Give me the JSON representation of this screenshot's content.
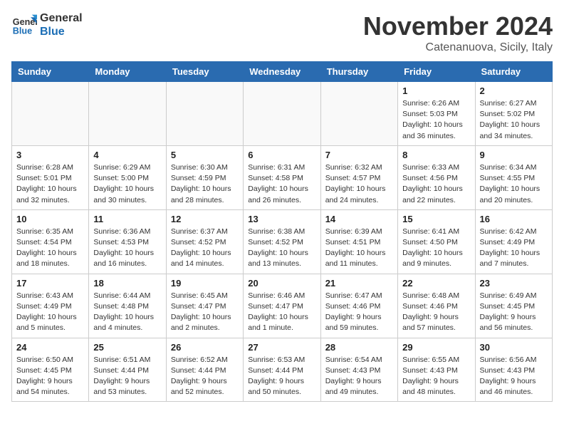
{
  "header": {
    "logo_line1": "General",
    "logo_line2": "Blue",
    "month_title": "November 2024",
    "location": "Catenanuova, Sicily, Italy"
  },
  "weekdays": [
    "Sunday",
    "Monday",
    "Tuesday",
    "Wednesday",
    "Thursday",
    "Friday",
    "Saturday"
  ],
  "weeks": [
    [
      {
        "day": "",
        "info": ""
      },
      {
        "day": "",
        "info": ""
      },
      {
        "day": "",
        "info": ""
      },
      {
        "day": "",
        "info": ""
      },
      {
        "day": "",
        "info": ""
      },
      {
        "day": "1",
        "info": "Sunrise: 6:26 AM\nSunset: 5:03 PM\nDaylight: 10 hours and 36 minutes."
      },
      {
        "day": "2",
        "info": "Sunrise: 6:27 AM\nSunset: 5:02 PM\nDaylight: 10 hours and 34 minutes."
      }
    ],
    [
      {
        "day": "3",
        "info": "Sunrise: 6:28 AM\nSunset: 5:01 PM\nDaylight: 10 hours and 32 minutes."
      },
      {
        "day": "4",
        "info": "Sunrise: 6:29 AM\nSunset: 5:00 PM\nDaylight: 10 hours and 30 minutes."
      },
      {
        "day": "5",
        "info": "Sunrise: 6:30 AM\nSunset: 4:59 PM\nDaylight: 10 hours and 28 minutes."
      },
      {
        "day": "6",
        "info": "Sunrise: 6:31 AM\nSunset: 4:58 PM\nDaylight: 10 hours and 26 minutes."
      },
      {
        "day": "7",
        "info": "Sunrise: 6:32 AM\nSunset: 4:57 PM\nDaylight: 10 hours and 24 minutes."
      },
      {
        "day": "8",
        "info": "Sunrise: 6:33 AM\nSunset: 4:56 PM\nDaylight: 10 hours and 22 minutes."
      },
      {
        "day": "9",
        "info": "Sunrise: 6:34 AM\nSunset: 4:55 PM\nDaylight: 10 hours and 20 minutes."
      }
    ],
    [
      {
        "day": "10",
        "info": "Sunrise: 6:35 AM\nSunset: 4:54 PM\nDaylight: 10 hours and 18 minutes."
      },
      {
        "day": "11",
        "info": "Sunrise: 6:36 AM\nSunset: 4:53 PM\nDaylight: 10 hours and 16 minutes."
      },
      {
        "day": "12",
        "info": "Sunrise: 6:37 AM\nSunset: 4:52 PM\nDaylight: 10 hours and 14 minutes."
      },
      {
        "day": "13",
        "info": "Sunrise: 6:38 AM\nSunset: 4:52 PM\nDaylight: 10 hours and 13 minutes."
      },
      {
        "day": "14",
        "info": "Sunrise: 6:39 AM\nSunset: 4:51 PM\nDaylight: 10 hours and 11 minutes."
      },
      {
        "day": "15",
        "info": "Sunrise: 6:41 AM\nSunset: 4:50 PM\nDaylight: 10 hours and 9 minutes."
      },
      {
        "day": "16",
        "info": "Sunrise: 6:42 AM\nSunset: 4:49 PM\nDaylight: 10 hours and 7 minutes."
      }
    ],
    [
      {
        "day": "17",
        "info": "Sunrise: 6:43 AM\nSunset: 4:49 PM\nDaylight: 10 hours and 5 minutes."
      },
      {
        "day": "18",
        "info": "Sunrise: 6:44 AM\nSunset: 4:48 PM\nDaylight: 10 hours and 4 minutes."
      },
      {
        "day": "19",
        "info": "Sunrise: 6:45 AM\nSunset: 4:47 PM\nDaylight: 10 hours and 2 minutes."
      },
      {
        "day": "20",
        "info": "Sunrise: 6:46 AM\nSunset: 4:47 PM\nDaylight: 10 hours and 1 minute."
      },
      {
        "day": "21",
        "info": "Sunrise: 6:47 AM\nSunset: 4:46 PM\nDaylight: 9 hours and 59 minutes."
      },
      {
        "day": "22",
        "info": "Sunrise: 6:48 AM\nSunset: 4:46 PM\nDaylight: 9 hours and 57 minutes."
      },
      {
        "day": "23",
        "info": "Sunrise: 6:49 AM\nSunset: 4:45 PM\nDaylight: 9 hours and 56 minutes."
      }
    ],
    [
      {
        "day": "24",
        "info": "Sunrise: 6:50 AM\nSunset: 4:45 PM\nDaylight: 9 hours and 54 minutes."
      },
      {
        "day": "25",
        "info": "Sunrise: 6:51 AM\nSunset: 4:44 PM\nDaylight: 9 hours and 53 minutes."
      },
      {
        "day": "26",
        "info": "Sunrise: 6:52 AM\nSunset: 4:44 PM\nDaylight: 9 hours and 52 minutes."
      },
      {
        "day": "27",
        "info": "Sunrise: 6:53 AM\nSunset: 4:44 PM\nDaylight: 9 hours and 50 minutes."
      },
      {
        "day": "28",
        "info": "Sunrise: 6:54 AM\nSunset: 4:43 PM\nDaylight: 9 hours and 49 minutes."
      },
      {
        "day": "29",
        "info": "Sunrise: 6:55 AM\nSunset: 4:43 PM\nDaylight: 9 hours and 48 minutes."
      },
      {
        "day": "30",
        "info": "Sunrise: 6:56 AM\nSunset: 4:43 PM\nDaylight: 9 hours and 46 minutes."
      }
    ]
  ]
}
